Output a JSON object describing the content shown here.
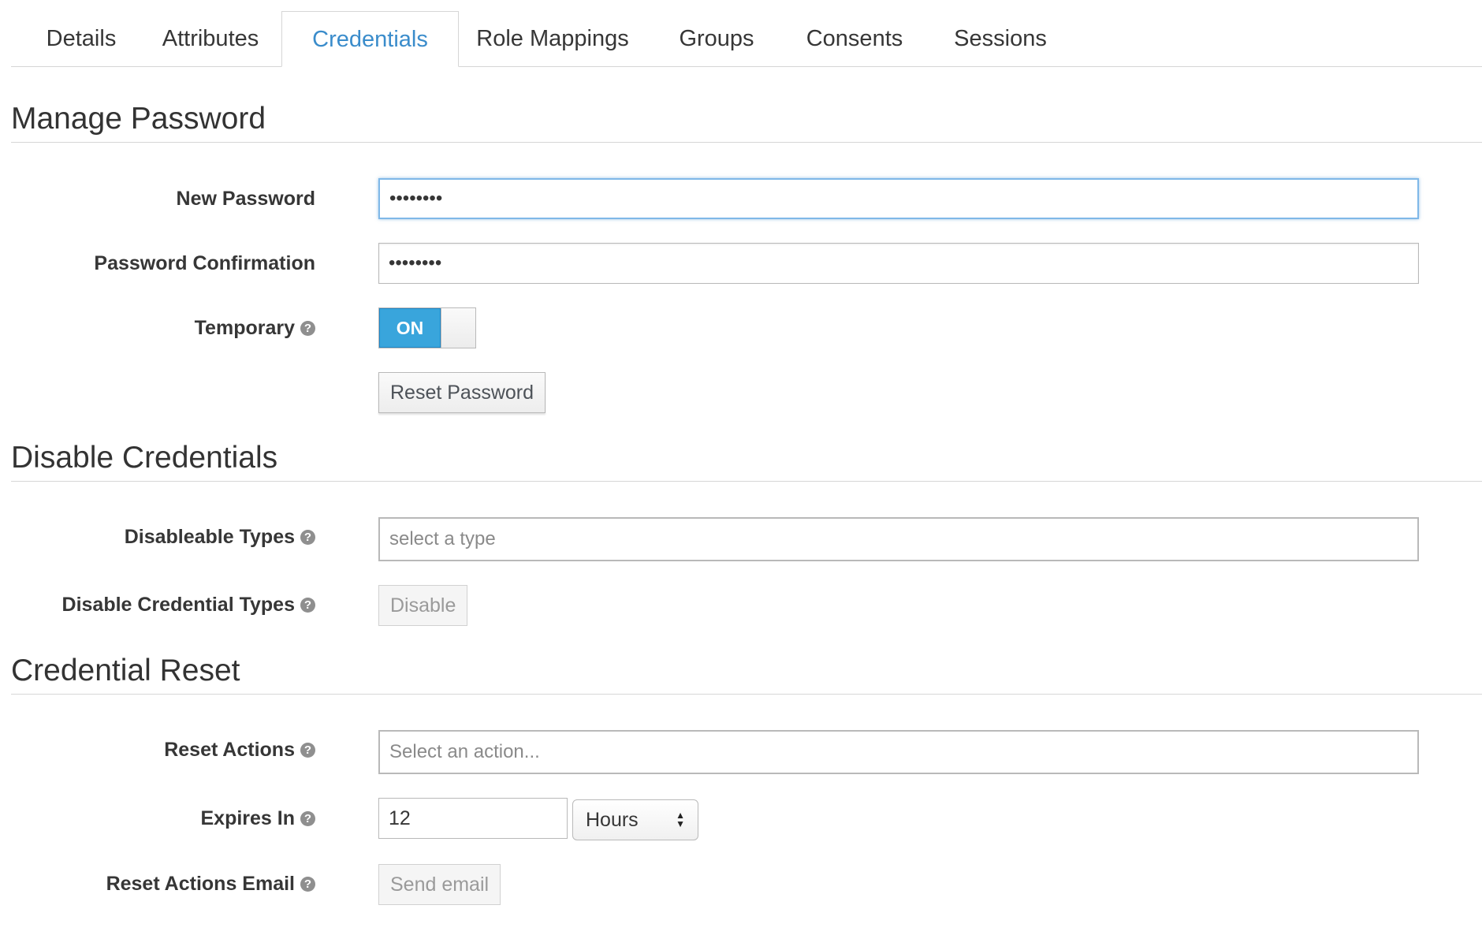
{
  "tabs": [
    {
      "label": "Details"
    },
    {
      "label": "Attributes"
    },
    {
      "label": "Credentials",
      "active": true
    },
    {
      "label": "Role Mappings"
    },
    {
      "label": "Groups"
    },
    {
      "label": "Consents"
    },
    {
      "label": "Sessions"
    }
  ],
  "manage_password": {
    "title": "Manage Password",
    "new_password_label": "New Password",
    "new_password_value": "••••••••",
    "confirm_label": "Password Confirmation",
    "confirm_value": "••••••••",
    "temporary_label": "Temporary",
    "temporary_state": "ON",
    "reset_button": "Reset Password"
  },
  "disable_credentials": {
    "title": "Disable Credentials",
    "types_label": "Disableable Types",
    "types_placeholder": "select a type",
    "disable_label": "Disable Credential Types",
    "disable_button": "Disable"
  },
  "credential_reset": {
    "title": "Credential Reset",
    "actions_label": "Reset Actions",
    "actions_placeholder": "Select an action...",
    "expires_label": "Expires In",
    "expires_value": "12",
    "expires_unit": "Hours",
    "email_label": "Reset Actions Email",
    "email_button": "Send email"
  },
  "icons": {
    "help": "question-circle-icon",
    "select_arrows": "up-down-arrows-icon"
  },
  "colors": {
    "accent": "#3a8ccb",
    "toggle_on": "#39a5dc"
  }
}
